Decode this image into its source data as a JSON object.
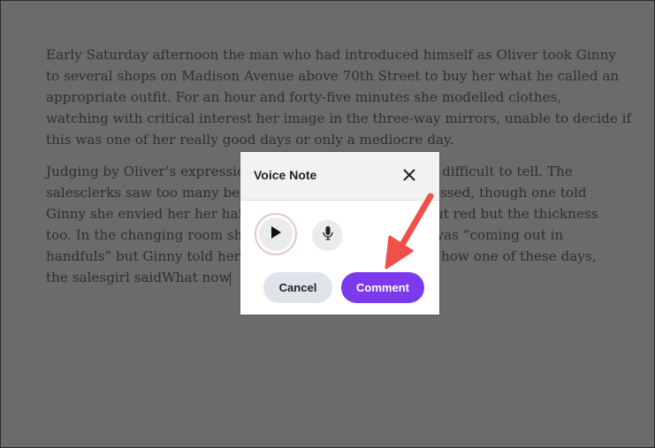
{
  "document": {
    "paragraph1": [
      "Early Saturday afternoon the man who had introduced himself as Oliver took Ginny",
      "to several shops on Madison Avenue above 70th Street to buy her what he called an",
      "appropriate outfit. For an hour and forty-five minutes she modelled clothes,",
      "watching with critical interest her image in the three-way mirrors, unable to decide if",
      "this was one of her really good days or only a mediocre day."
    ],
    "paragraph2_left": [
      "Judging by Oliver’s expression",
      "salesclerks saw too many beau",
      "Ginny she envied her her hair-",
      "too. In the changing room she",
      "handfuls” but Ginny told her i",
      "the salesgirl saidWhat now"
    ],
    "paragraph2_right": [
      "difficult to tell. The",
      "essed, though one told",
      "ut red but the thickness",
      "was “coming out in",
      "how one of these days,",
      ""
    ]
  },
  "modal": {
    "title": "Voice Note",
    "close_icon": "close-icon",
    "play_icon": "play-icon",
    "mic_icon": "microphone-icon",
    "cancel_label": "Cancel",
    "comment_label": "Comment"
  },
  "colors": {
    "accent": "#7c3aed",
    "annotation_arrow": "#f0504a"
  }
}
